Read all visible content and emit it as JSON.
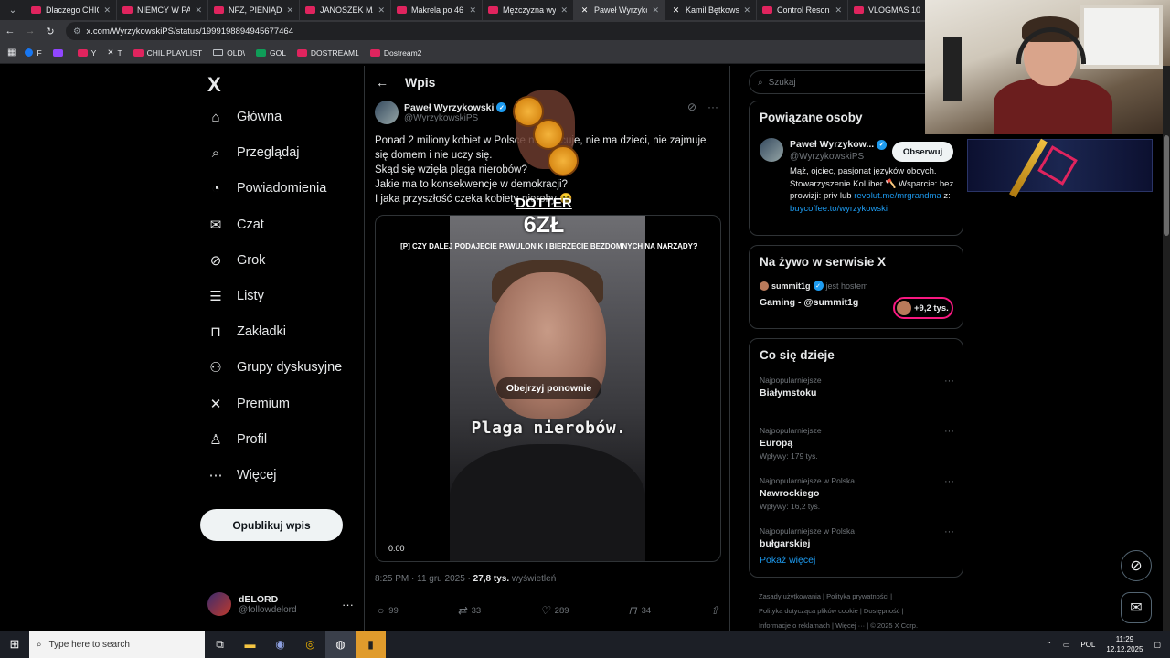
{
  "browser": {
    "tabs": [
      {
        "label": "Dlaczego CHIC",
        "icon": "youtube-icon"
      },
      {
        "label": "NIEMCY W PA",
        "icon": "youtube-icon"
      },
      {
        "label": "NFZ, PIENIĄDZ",
        "icon": "youtube-icon"
      },
      {
        "label": "JANOSZEK MA",
        "icon": "youtube-icon"
      },
      {
        "label": "Makrela po 46",
        "icon": "youtube-icon"
      },
      {
        "label": "Mężczyzna wyp",
        "icon": "youtube-icon"
      },
      {
        "label": "Paweł Wyrzyko",
        "icon": "x-icon",
        "active": true
      },
      {
        "label": "Kamil Bętkows",
        "icon": "x-icon"
      },
      {
        "label": "Control Resonan",
        "icon": "youtube-icon"
      },
      {
        "label": "VLOGMAS 10",
        "icon": "youtube-icon"
      }
    ],
    "url": "x.com/WyrzykowskiPS/status/1999198894945677464",
    "bookmarks": [
      {
        "label": "F",
        "icon": "facebook-icon"
      },
      {
        "label": "",
        "icon": "twitch-icon"
      },
      {
        "label": "Y",
        "icon": "youtube-icon"
      },
      {
        "label": "T",
        "icon": "x-icon"
      },
      {
        "label": "CHIL PLAYLIST",
        "icon": "youtube-icon"
      },
      {
        "label": "OLD\\",
        "icon": "folder-icon"
      },
      {
        "label": "GOL",
        "icon": "g-icon"
      },
      {
        "label": "DOSTREAM1",
        "icon": "youtube-icon"
      },
      {
        "label": "Dostream2",
        "icon": "youtube-icon"
      }
    ]
  },
  "sidebar": {
    "logo": "X",
    "items": [
      {
        "label": "Główna",
        "icon": "home-icon"
      },
      {
        "label": "Przeglądaj",
        "icon": "search-icon"
      },
      {
        "label": "Powiadomienia",
        "icon": "bell-icon"
      },
      {
        "label": "Czat",
        "icon": "mail-icon"
      },
      {
        "label": "Grok",
        "icon": "grok-icon"
      },
      {
        "label": "Listy",
        "icon": "list-icon"
      },
      {
        "label": "Zakładki",
        "icon": "bookmark-icon"
      },
      {
        "label": "Grupy dyskusyjne",
        "icon": "people-icon"
      },
      {
        "label": "Premium",
        "icon": "x-icon"
      },
      {
        "label": "Profil",
        "icon": "person-icon"
      },
      {
        "label": "Więcej",
        "icon": "more-circle-icon"
      }
    ],
    "post_button": "Opublikuj wpis",
    "account": {
      "name": "dELORD",
      "handle": "@followdelord"
    }
  },
  "main": {
    "header_title": "Wpis",
    "author": {
      "name": "Paweł Wyrzykowski",
      "handle": "@WyrzykowskiPS"
    },
    "text_lines": [
      "Ponad 2 miliony kobiet w Polsce nie pracuje, nie ma dzieci, nie zajmuje",
      "się domem i nie uczy się.",
      "Skąd się wzięła plaga nierobów?",
      "Jakie ma to konsekwencje w demokracji?",
      "I jaka przyszłość czeka kobiety-nieroby 🙁"
    ],
    "video": {
      "top_caption": "[P] CZY DALEJ PODAJECIE PAWULONIK I BIERZECIE BEZDOMNYCH NA NARZĄDY?",
      "replay_label": "Obejrzyj ponownie",
      "caption": "Plaga nierobów.",
      "time": "0:00"
    },
    "meta": {
      "time": "8:25 PM · 11 gru 2025 ·",
      "views": "27,8 tys.",
      "views_label": "wyświetleń"
    },
    "actions": {
      "replies": "99",
      "reposts": "33",
      "likes": "289",
      "bookmarks": "34"
    }
  },
  "donation": {
    "name": "DOTTER",
    "amount": "6ZŁ"
  },
  "right": {
    "search_placeholder": "Szukaj",
    "related": {
      "title": "Powiązane osoby",
      "name": "Paweł Wyrzykow...",
      "handle": "@WyrzykowskiPS",
      "follow_label": "Obserwuj",
      "bio_1": "Mąż, ojciec, pasjonat języków obcych. Stowarzyszenie KoLiber 🪓 Wsparcie: bez prowizji: priv lub",
      "bio_link_1": "revolut.me/mrgrandma",
      "bio_mid": " z:",
      "bio_link_2": "buycoffee.to/wyrzykowski"
    },
    "live": {
      "title": "Na żywo w serwisie X",
      "host_name": "summit1g",
      "host_label": "jest hostem",
      "stream_title": "Gaming - @summit1g",
      "viewers": "+9,2 tys."
    },
    "trends": {
      "title": "Co się dzieje",
      "items": [
        {
          "category": "Najpopularniejsze",
          "title": "Białymstoku",
          "sub": ""
        },
        {
          "category": "Najpopularniejsze",
          "title": "Europą",
          "sub": "Wpływy: 179 tys."
        },
        {
          "category": "Najpopularniejsze w Polska",
          "title": "Nawrockiego",
          "sub": "Wpływy: 16,2 tys."
        },
        {
          "category": "Najpopularniejsze w Polska",
          "title": "bułgarskiej",
          "sub": ""
        }
      ],
      "more": "Pokaż więcej"
    },
    "footer": {
      "l1": "Zasady użytkowania | Polityka prywatności |",
      "l2": "Polityka dotycząca plików cookie | Dostępność |",
      "l3": "Informacje o reklamach | Więcej ··· | © 2025 X Corp."
    }
  },
  "taskbar": {
    "search_placeholder": "Type here to search",
    "lang": "POL",
    "time": "11:29",
    "date": "12.12.2025"
  }
}
